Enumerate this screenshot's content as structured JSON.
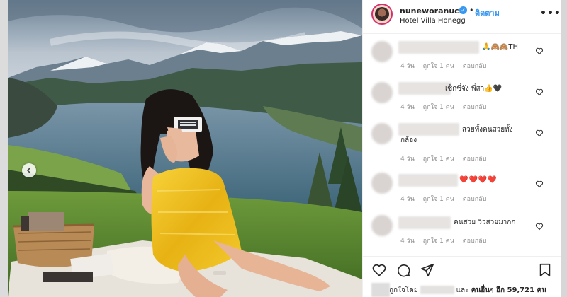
{
  "post": {
    "username": "nuneworanuch",
    "follow_label": "ติดตาม",
    "separator": "•",
    "location": "Hotel Villa Honegg",
    "more_label": "•••"
  },
  "photo": {
    "description_icons": [
      "carousel-prev-icon"
    ]
  },
  "comments": [
    {
      "text": "🙏🙈🙈TH",
      "time": "4 วัน",
      "likes": "ถูกใจ 1 คน",
      "reply": "ตอบกลับ"
    },
    {
      "text": "เซ็กซี่จัง พี่สา👍🖤",
      "time": "4 วัน",
      "likes": "ถูกใจ 1 คน",
      "reply": "ตอบกลับ"
    },
    {
      "text_line1": "สวยทั้งคนสวยทั้ง",
      "text_line2": "กล้อง",
      "time": "4 วัน",
      "likes": "ถูกใจ 1 คน",
      "reply": "ตอบกลับ"
    },
    {
      "text": "❤️❤️❤️❤️",
      "time": "4 วัน",
      "likes": "ถูกใจ 1 คน",
      "reply": "ตอบกลับ"
    },
    {
      "text": "คนสวย วิวสวยมากก",
      "time": "4 วัน",
      "likes": "ถูกใจ 1 คน",
      "reply": "ตอบกลับ"
    }
  ],
  "likes_summary": {
    "prefix": "ถูกใจโดย",
    "middle": "และ",
    "others": "คนอื่นๆ อีก 59,721 คน"
  },
  "colors": {
    "accent": "#3897f0",
    "text": "#262626",
    "muted": "#8e8e8e"
  }
}
